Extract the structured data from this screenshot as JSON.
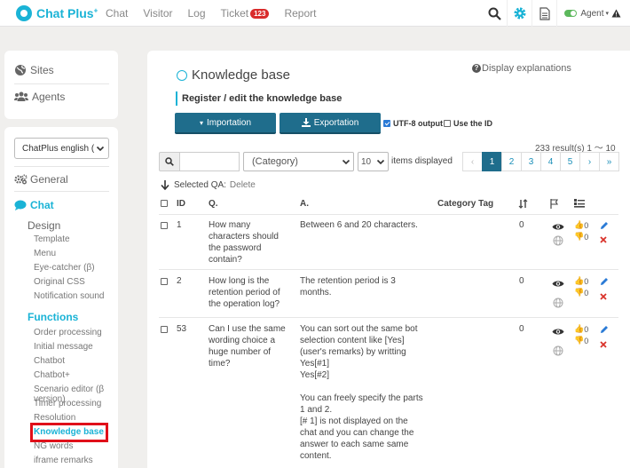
{
  "brand": {
    "name": "Chat Plus",
    "sup": "+"
  },
  "nav": [
    {
      "label": "Chat"
    },
    {
      "label": "Visitor"
    },
    {
      "label": "Log"
    },
    {
      "label": "Ticket",
      "badge": "123"
    },
    {
      "label": "Report"
    }
  ],
  "agent": {
    "label": "Agent"
  },
  "sidebar": {
    "sites": "Sites",
    "agents": "Agents",
    "site_select": "ChatPlus english (",
    "general": "General",
    "chat": "Chat",
    "design": "Design",
    "design_items": [
      "Template",
      "Menu",
      "Eye-catcher (β)",
      "Original CSS",
      "Notification sound"
    ],
    "functions": "Functions",
    "function_items": [
      "Order processing",
      "Initial message",
      "Chatbot",
      "Chatbot+",
      "Scenario editor (β version)",
      "Timer processing",
      "Resolution confirmation",
      "Knowledge base",
      "NG words",
      "iframe remarks"
    ],
    "active_item": "Knowledge base"
  },
  "main": {
    "title": "Knowledge base",
    "explain": "Display explanations",
    "subtitle": "Register / edit the knowledge base",
    "import_btn": "Importation",
    "export_btn": "Exportation",
    "utf8": "UTF-8 output",
    "use_id": "Use the ID",
    "result": "233 result(s) 1 〜 10",
    "category_placeholder": "(Category)",
    "per_page": "10",
    "items_displayed": "items displayed",
    "pager": [
      "‹",
      "1",
      "2",
      "3",
      "4",
      "5",
      "›",
      "»"
    ],
    "current_page": "1",
    "selected_qa": "Selected QA:",
    "delete": "Delete"
  },
  "table": {
    "headers": {
      "id": "ID",
      "q": "Q.",
      "a": "A.",
      "cat": "Category Tag"
    },
    "rows": [
      {
        "id": "1",
        "q": [
          "How many",
          "characters should",
          "the password",
          "contain?"
        ],
        "a": [
          "Between 6 and 20 characters."
        ],
        "count": "0",
        "up": "0",
        "down": "0"
      },
      {
        "id": "2",
        "q": [
          "How long is the",
          "retention period of",
          "the operation log?"
        ],
        "a": [
          "The retention period is 3",
          "months."
        ],
        "count": "0",
        "up": "0",
        "down": "0"
      },
      {
        "id": "53",
        "q": [
          "Can I use the same",
          "wording choice a",
          "huge number of",
          "time?"
        ],
        "a": [
          "You can sort out the same bot",
          "selection content like [Yes]",
          "(user's remarks) by writting",
          "Yes[#1]",
          "Yes[#2]",
          "",
          "You can freely specify the parts",
          "1 and 2.",
          "[# 1] is not displayed on the",
          "chat and you can change the",
          "answer to each same same",
          "content."
        ],
        "count": "0",
        "up": "0",
        "down": "0"
      }
    ]
  },
  "colors": {
    "accent": "#1ab3d6",
    "button": "#1f6d8c",
    "badge": "#d92b2b",
    "active_outline": "#e0101a"
  }
}
